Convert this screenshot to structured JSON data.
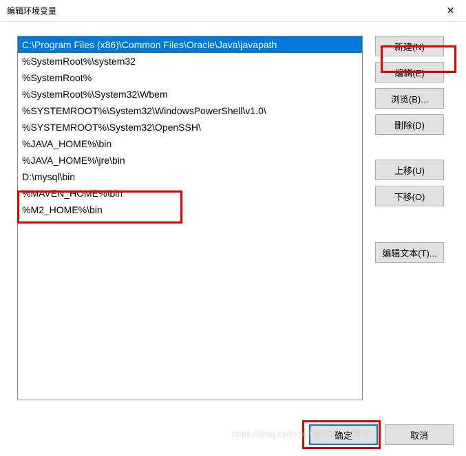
{
  "titlebar": {
    "title": "编辑环境变量"
  },
  "list": {
    "items": [
      {
        "text": "C:\\Program Files (x86)\\Common Files\\Oracle\\Java\\javapath",
        "selected": true
      },
      {
        "text": "%SystemRoot%\\system32",
        "selected": false
      },
      {
        "text": "%SystemRoot%",
        "selected": false
      },
      {
        "text": "%SystemRoot%\\System32\\Wbem",
        "selected": false
      },
      {
        "text": "%SYSTEMROOT%\\System32\\WindowsPowerShell\\v1.0\\",
        "selected": false
      },
      {
        "text": "%SYSTEMROOT%\\System32\\OpenSSH\\",
        "selected": false
      },
      {
        "text": "%JAVA_HOME%\\bin",
        "selected": false
      },
      {
        "text": "%JAVA_HOME%\\jre\\bin",
        "selected": false
      },
      {
        "text": "D:\\mysql\\bin",
        "selected": false
      },
      {
        "text": "%MAVEN_HOME%\\bin",
        "selected": false
      },
      {
        "text": "%M2_HOME%\\bin",
        "selected": false
      }
    ]
  },
  "buttons": {
    "new": "新建(N)",
    "edit": "编辑(E)",
    "browse": "浏览(B)...",
    "delete": "删除(D)",
    "moveup": "上移(U)",
    "movedown": "下移(O)",
    "edittext": "编辑文本(T)...",
    "ok": "确定",
    "cancel": "取消"
  },
  "watermark": "https://blog.csdn.net/@51CTO博客"
}
